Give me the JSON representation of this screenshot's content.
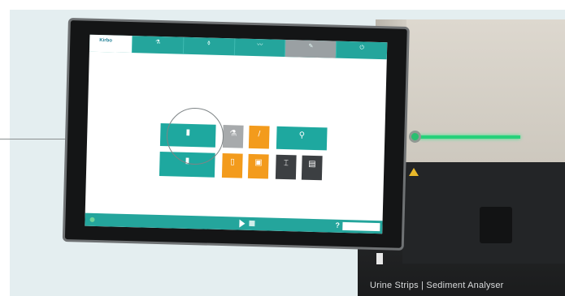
{
  "device": {
    "label": "Urine Strips | Sediment Analyser"
  },
  "app": {
    "logo_text": "Kirbo",
    "tabs": [
      {
        "label": "",
        "icon": "flask-icon"
      },
      {
        "label": "",
        "icon": "tube-icon"
      },
      {
        "label": "",
        "icon": "chart-icon"
      },
      {
        "label": "",
        "icon": "pen-icon"
      },
      {
        "label": "",
        "icon": "power-icon"
      }
    ],
    "tiles": [
      {
        "label": "",
        "icon": "urine-cup-icon",
        "color": "#1ea89f"
      },
      {
        "label": "",
        "icon": "bottle-icon",
        "color": "#a7aaac"
      },
      {
        "label": "",
        "icon": "pencil-icon",
        "color": "#f39b1c"
      },
      {
        "label": "",
        "icon": "microscope-icon",
        "color": "#1ea89f"
      },
      {
        "label": "",
        "icon": "sample-cup-icon",
        "color": "#1ea89f"
      },
      {
        "label": "",
        "icon": "strip-icon",
        "color": "#f39b1c"
      },
      {
        "label": "",
        "icon": "strip-cup-icon",
        "color": "#f39b1c"
      },
      {
        "label": "",
        "icon": "calibration-icon",
        "color": "#3c3f42"
      },
      {
        "label": "",
        "icon": "data-icon",
        "color": "#3c3f42"
      }
    ],
    "status": {
      "ready_text": "",
      "user_text": "",
      "date_text": "",
      "help_glyph": "?"
    }
  },
  "colors": {
    "teal": "#24a59c",
    "orange": "#f39b1c",
    "grey": "#a7aaac",
    "dark": "#3c3f42",
    "device_light": "#27d07a"
  }
}
